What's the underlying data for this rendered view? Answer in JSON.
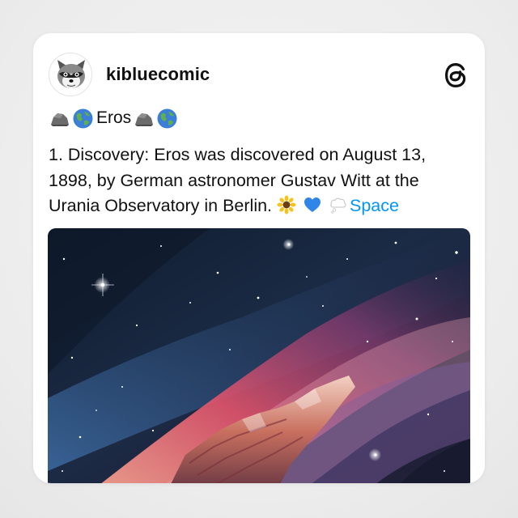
{
  "post": {
    "username": "kibluecomic",
    "title": {
      "text": "Eros",
      "leading_icons": [
        "rock-emoji",
        "globe-emoji"
      ],
      "trailing_icons": [
        "rock-emoji",
        "globe-emoji"
      ]
    },
    "body": "1. Discovery: Eros was discovered on August 13, 1898, by German astronomer Gustav Witt at the Urania Observatory in Berlin.",
    "trailing_emojis": [
      "sunflower-emoji",
      "blue-heart-emoji",
      "thought-bubble-emoji"
    ],
    "tag": "Space",
    "image_description_icon": "space-nebula-painting"
  },
  "app": {
    "logo_icon": "threads-logo-icon"
  },
  "colors": {
    "link": "#0095f6",
    "text": "#111111",
    "card_bg": "#ffffff",
    "page_bg": "#eeeeee"
  }
}
